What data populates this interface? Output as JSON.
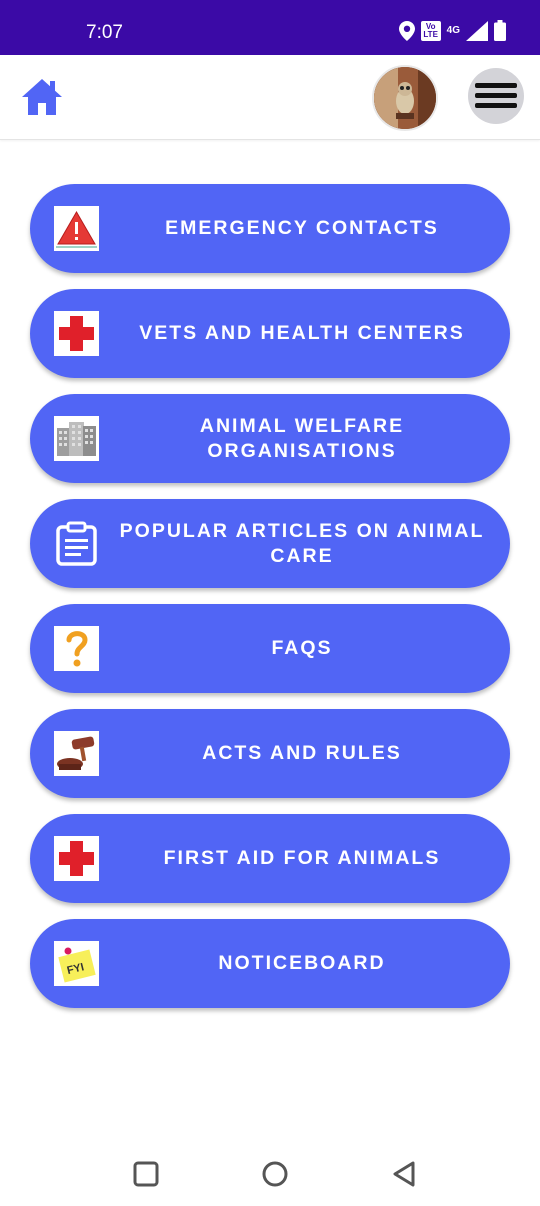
{
  "status_bar": {
    "time": "7:07",
    "network_label": "4G",
    "lte_label": "Vo LTE"
  },
  "app_bar": {
    "home_icon": "home-icon",
    "avatar_icon": "owl-avatar",
    "menu_icon": "hamburger-menu-icon"
  },
  "accent_color": "#5165f5",
  "status_bar_color": "#3b0aa6",
  "menu_items": [
    {
      "label": "EMERGENCY CONTACTS",
      "icon": "warning-icon"
    },
    {
      "label": "VETS AND HEALTH CENTERS",
      "icon": "red-cross-icon"
    },
    {
      "label": "ANIMAL WELFARE ORGANISATIONS",
      "icon": "buildings-icon"
    },
    {
      "label": "POPULAR ARTICLES ON ANIMAL CARE",
      "icon": "clipboard-icon"
    },
    {
      "label": "FAQS",
      "icon": "question-icon"
    },
    {
      "label": "ACTS AND RULES",
      "icon": "gavel-icon"
    },
    {
      "label": "FIRST AID FOR ANIMALS",
      "icon": "red-cross-icon"
    },
    {
      "label": "NOTICEBOARD",
      "icon": "fyi-note-icon"
    }
  ],
  "nav_bar": {
    "recents_icon": "square-recents-icon",
    "home_icon": "circle-home-icon",
    "back_icon": "triangle-back-icon"
  }
}
